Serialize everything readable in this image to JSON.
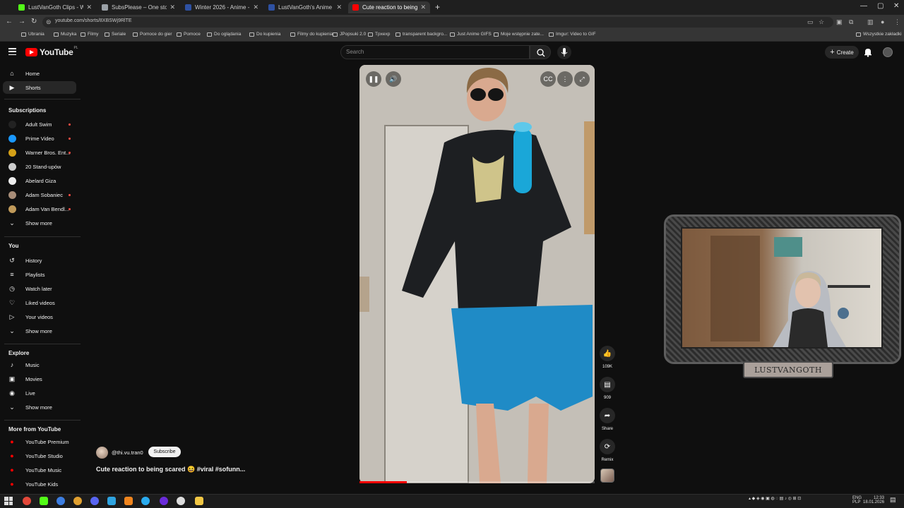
{
  "browser": {
    "tabs": [
      {
        "title": "LustVanGoth Clips - Watch Live",
        "color": "#53fc18",
        "active": false
      },
      {
        "title": "SubsPlease – One stop shop fo",
        "color": "#9aa0a6",
        "active": false
      },
      {
        "title": "Winter 2026 - Anime - MyAnim",
        "color": "#2e51a2",
        "active": false
      },
      {
        "title": "LustVanGoth's Anime List - My",
        "color": "#2e51a2",
        "active": false
      },
      {
        "title": "Cute reaction to being scar",
        "color": "#ff0000",
        "active": true
      }
    ],
    "new_tab": "+",
    "url": "youtube.com/shorts/8XBSWj9RlTE",
    "bookmarks": [
      "Ubrania",
      "Muzyka",
      "Filmy",
      "Seriale",
      "Pomoce do gier",
      "Pomoce",
      "Do oglądania",
      "Do kupienia",
      "Filmy do kupienia",
      "JPopsuki 2.0",
      "Tpxexp",
      "transparent backgro...",
      "Just Anime GIFS",
      "Moje wstępnie zate...",
      "Imgur: Video to GIF"
    ],
    "all_bookmarks": "Wszystkie zakładki"
  },
  "youtube": {
    "logo_text": "YouTube",
    "country_code": "PL",
    "search_placeholder": "Search",
    "create_label": "Create",
    "sidebar": {
      "main": [
        {
          "label": "Home",
          "icon": "home-icon",
          "glyph": "⌂"
        },
        {
          "label": "Shorts",
          "icon": "shorts-icon",
          "glyph": "▶",
          "active": true
        }
      ],
      "subscriptions_heading": "Subscriptions",
      "subscriptions": [
        {
          "label": "Adult Swim",
          "color": "#222222",
          "live": true
        },
        {
          "label": "Prime Video",
          "color": "#1a98ff",
          "live": true
        },
        {
          "label": "Warner Bros. Ent...",
          "color": "#d4a017",
          "live": true
        },
        {
          "label": "20 Stand-upów",
          "color": "#cccccc",
          "live": false
        },
        {
          "label": "Abelard Giza",
          "color": "#eeeeee",
          "live": false
        },
        {
          "label": "Adam Sobaniec",
          "color": "#a88d78",
          "live": true
        },
        {
          "label": "Adam Van Bendl...",
          "color": "#c09a5a",
          "live": true
        }
      ],
      "show_more": "Show more",
      "you_heading": "You",
      "you": [
        {
          "label": "History",
          "icon": "history-icon",
          "glyph": "↺"
        },
        {
          "label": "Playlists",
          "icon": "playlists-icon",
          "glyph": "≡"
        },
        {
          "label": "Watch later",
          "icon": "watch-later-icon",
          "glyph": "◷"
        },
        {
          "label": "Liked videos",
          "icon": "liked-videos-icon",
          "glyph": "♡"
        },
        {
          "label": "Your videos",
          "icon": "your-videos-icon",
          "glyph": "▷"
        }
      ],
      "explore_heading": "Explore",
      "explore": [
        {
          "label": "Music",
          "icon": "music-icon",
          "glyph": "♪"
        },
        {
          "label": "Movies",
          "icon": "movies-icon",
          "glyph": "▣"
        },
        {
          "label": "Live",
          "icon": "live-icon",
          "glyph": "◉"
        }
      ],
      "more_heading": "More from YouTube",
      "more": [
        {
          "label": "YouTube Premium",
          "color": "#ff0000"
        },
        {
          "label": "YouTube Studio",
          "color": "#ff0000"
        },
        {
          "label": "YouTube Music",
          "color": "#ff0000"
        },
        {
          "label": "YouTube Kids",
          "color": "#ff0000"
        }
      ]
    },
    "short": {
      "channel": "@thi.vu.tran0",
      "subscribe_label": "Subscribe",
      "title": "Cute reaction to being scared 😆 #viral #sofunn...",
      "progress": 0.2,
      "actions": {
        "likes": "109K",
        "comments": "909",
        "share": "Share",
        "remix": "Remix"
      }
    }
  },
  "overlay": {
    "streamer_name": "LUSTVANGOTH"
  },
  "taskbar": {
    "language": "ENG",
    "layout": "PLP",
    "time": "12:33",
    "date": "18.01.2026"
  }
}
